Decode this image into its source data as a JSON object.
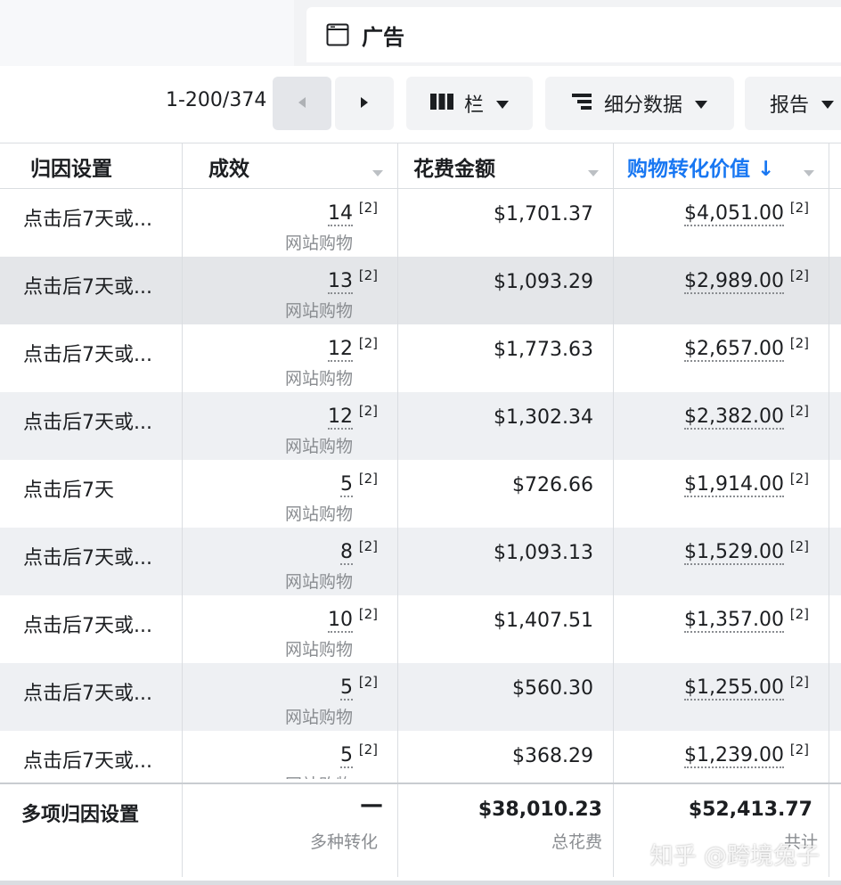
{
  "tab": {
    "label": "广告"
  },
  "toolbar": {
    "pagination": "1-200/374",
    "columns_label": "栏",
    "breakdown_label": "细分数据",
    "reports_label": "报告"
  },
  "table": {
    "headers": {
      "attribution": "归因设置",
      "results": "成效",
      "spend": "花费金额",
      "purchase_value": "购物转化价值 ↓"
    },
    "rows": [
      {
        "attribution": "点击后7天或...",
        "results": "14",
        "results_ref": "[2]",
        "results_sub": "网站购物",
        "spend": "$1,701.37",
        "purchase_value": "$4,051.00",
        "value_ref": "[2]"
      },
      {
        "attribution": "点击后7天或...",
        "results": "13",
        "results_ref": "[2]",
        "results_sub": "网站购物",
        "spend": "$1,093.29",
        "purchase_value": "$2,989.00",
        "value_ref": "[2]"
      },
      {
        "attribution": "点击后7天或...",
        "results": "12",
        "results_ref": "[2]",
        "results_sub": "网站购物",
        "spend": "$1,773.63",
        "purchase_value": "$2,657.00",
        "value_ref": "[2]"
      },
      {
        "attribution": "点击后7天或...",
        "results": "12",
        "results_ref": "[2]",
        "results_sub": "网站购物",
        "spend": "$1,302.34",
        "purchase_value": "$2,382.00",
        "value_ref": "[2]"
      },
      {
        "attribution": "点击后7天",
        "results": "5",
        "results_ref": "[2]",
        "results_sub": "网站购物",
        "spend": "$726.66",
        "purchase_value": "$1,914.00",
        "value_ref": "[2]"
      },
      {
        "attribution": "点击后7天或...",
        "results": "8",
        "results_ref": "[2]",
        "results_sub": "网站购物",
        "spend": "$1,093.13",
        "purchase_value": "$1,529.00",
        "value_ref": "[2]"
      },
      {
        "attribution": "点击后7天或...",
        "results": "10",
        "results_ref": "[2]",
        "results_sub": "网站购物",
        "spend": "$1,407.51",
        "purchase_value": "$1,357.00",
        "value_ref": "[2]"
      },
      {
        "attribution": "点击后7天或...",
        "results": "5",
        "results_ref": "[2]",
        "results_sub": "网站购物",
        "spend": "$560.30",
        "purchase_value": "$1,255.00",
        "value_ref": "[2]"
      },
      {
        "attribution": "点击后7天或...",
        "results": "5",
        "results_ref": "[2]",
        "results_sub": "网站购物",
        "spend": "$368.29",
        "purchase_value": "$1,239.00",
        "value_ref": "[2]"
      }
    ],
    "totals": {
      "attribution": "多项归因设置",
      "results": "—",
      "results_sub": "多种转化",
      "spend": "$38,010.23",
      "spend_sub": "总花费",
      "purchase_value": "$52,413.77",
      "value_sub": "共计"
    }
  },
  "watermark": "知乎 @跨境兔子",
  "colors": {
    "accent": "#1877f2",
    "alt_row": "#eef0f3",
    "muted": "#8a8d91"
  }
}
